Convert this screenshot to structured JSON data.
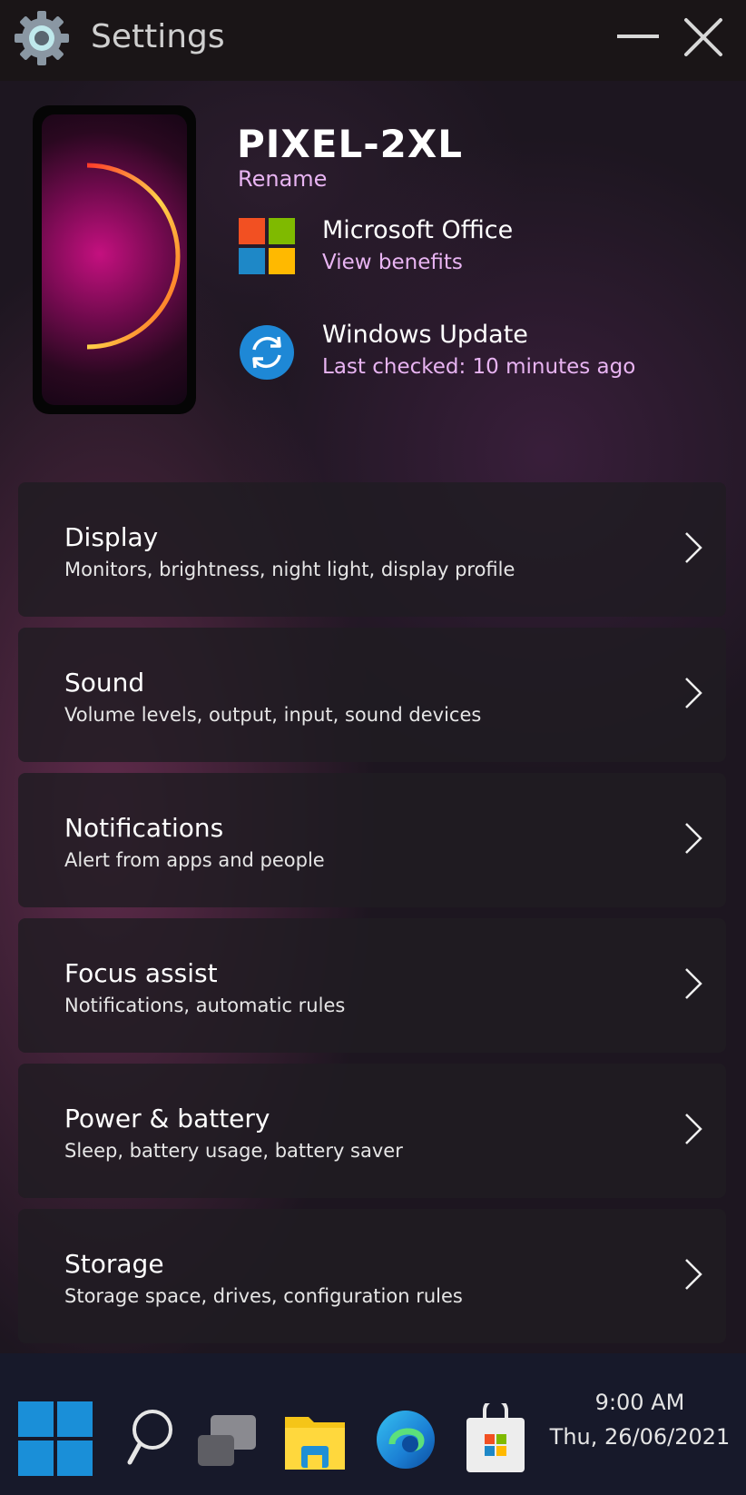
{
  "window": {
    "title": "Settings",
    "icons": {
      "app": "gear-icon",
      "minimize": "minimize-icon",
      "close": "close-icon"
    }
  },
  "device": {
    "name": "PIXEL-2XL",
    "rename_label": "Rename"
  },
  "promos": [
    {
      "icon": "microsoft-office-logo",
      "title": "Microsoft Office",
      "link": "View benefits"
    },
    {
      "icon": "windows-update-icon",
      "title": "Windows Update",
      "subtitle": "Last checked: 10 minutes ago"
    }
  ],
  "settings_list": [
    {
      "title": "Display",
      "subtitle": "Monitors, brightness, night light, display profile"
    },
    {
      "title": "Sound",
      "subtitle": "Volume levels, output, input, sound devices"
    },
    {
      "title": "Notifications",
      "subtitle": "Alert from apps and people"
    },
    {
      "title": "Focus assist",
      "subtitle": "Notifications, automatic rules"
    },
    {
      "title": "Power & battery",
      "subtitle": "Sleep, battery usage, battery saver"
    },
    {
      "title": "Storage",
      "subtitle": "Storage space, drives, configuration  rules"
    }
  ],
  "taskbar": {
    "apps": [
      "start-icon",
      "search-icon",
      "task-view-icon",
      "file-explorer-icon",
      "edge-icon",
      "store-icon"
    ],
    "time": "9:00 AM",
    "date": "Thu, 26/06/2021"
  },
  "colors": {
    "accent_link": "#e8b4f2",
    "background": "#1d1620",
    "taskbar": "#17192a"
  }
}
